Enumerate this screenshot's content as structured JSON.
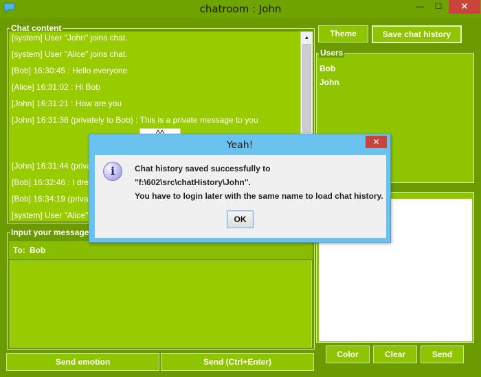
{
  "window": {
    "title": "chatroom : John",
    "icon": "chat-bubble-icon",
    "controls": {
      "minimize": "—",
      "maximize": "☐",
      "close": "✕"
    }
  },
  "chat_panel": {
    "title": "Chat content",
    "messages": [
      "[system] User \"John\" joins chat.",
      "[system] User \"Alice\" joins chat.",
      "[Bob] 16:30:45 : Hello everyone",
      "[Alice] 16:31:02 : Hi Bob",
      "[John] 16:31:21 : How are you",
      "[John] 16:31:38 (privately to Bob) : This is a private message to you",
      "[John] 16:31:44 (priva",
      "[Bob] 16:32:46 : I drew",
      "[Bob] 16:34:19 (privat",
      "[system] User \"Alice\""
    ],
    "emotion_glyph": "^^"
  },
  "input_panel": {
    "title": "Input your message",
    "to_label": "To:",
    "to_value": "Bob",
    "message_value": ""
  },
  "buttons": {
    "send_emotion": "Send emotion",
    "send": "Send (Ctrl+Enter)",
    "theme": "Theme",
    "save_history": "Save chat history",
    "color": "Color",
    "clear": "Clear",
    "draw_send": "Send"
  },
  "users_panel": {
    "title": "Users",
    "users": [
      "Bob",
      "John"
    ]
  },
  "dialog": {
    "title": "Yeah!",
    "line1": "Chat history saved successfully to",
    "line2": "\"f:\\602\\src\\chatHistory\\John\".",
    "line3": "You have to login later with the same name to load chat history.",
    "ok": "OK",
    "icon_glyph": "i",
    "close_glyph": "✕"
  },
  "colors": {
    "theme_dark_green": "#6b9b00",
    "theme_panel_green": "#8fc400",
    "theme_text_area_green": "#98cc00",
    "dialog_blue": "#6cc2ee",
    "close_red": "#c9453c"
  }
}
